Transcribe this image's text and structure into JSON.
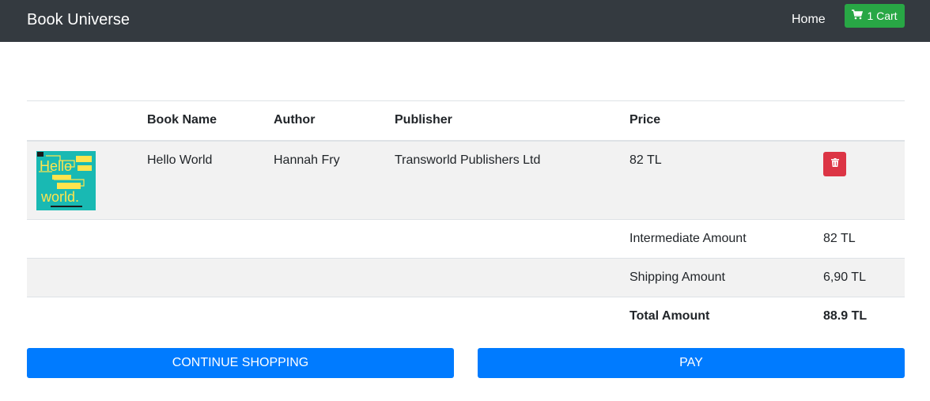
{
  "navbar": {
    "brand": "Book Universe",
    "home_label": "Home",
    "cart_label": "1 Cart",
    "cart_icon": "shopping-cart-icon"
  },
  "table": {
    "headers": [
      "",
      "Book Name",
      "Author",
      "Publisher",
      "Price",
      ""
    ],
    "items": [
      {
        "cover_icon": "book-cover-image",
        "cover_text": "Hello world.",
        "book_name": "Hello World",
        "author": "Hannah Fry",
        "publisher": "Transworld Publishers Ltd",
        "price": "82 TL",
        "delete_icon": "trash-icon"
      }
    ],
    "summary": {
      "intermediate_label": "Intermediate Amount",
      "intermediate_value": "82 TL",
      "shipping_label": "Shipping Amount",
      "shipping_value": "6,90 TL",
      "total_label": "Total Amount",
      "total_value": "88.9 TL"
    }
  },
  "actions": {
    "continue_label": "CONTINUE SHOPPING",
    "pay_label": "PAY"
  },
  "colors": {
    "navbar": "#343a40",
    "cart_button": "#28a745",
    "delete_button": "#dc3545",
    "primary_button": "#007bff",
    "stripe": "#f2f2f2"
  }
}
